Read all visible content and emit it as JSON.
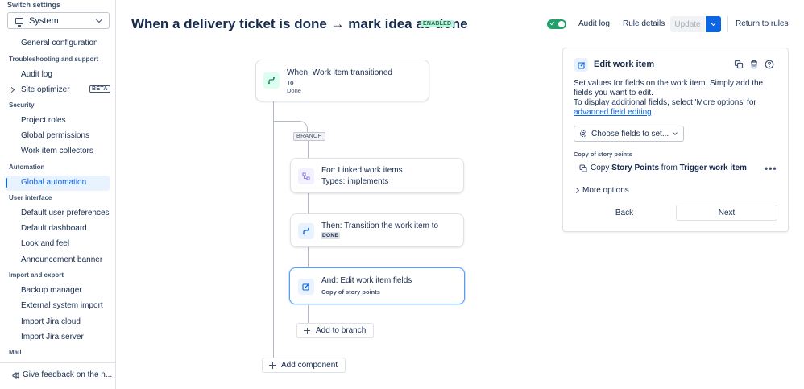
{
  "sidebar": {
    "switch_label": "Switch settings",
    "switch_value": "System",
    "sections": {
      "general": "General configuration",
      "troubleshooting": "Troubleshooting and support",
      "audit_log": "Audit log",
      "site_optimizer": "Site optimizer",
      "beta": "BETA",
      "security": "Security",
      "project_roles": "Project roles",
      "global_permissions": "Global permissions",
      "work_item_collectors": "Work item collectors",
      "automation": "Automation",
      "global_automation": "Global automation",
      "user_interface": "User interface",
      "default_user_preferences": "Default user preferences",
      "default_dashboard": "Default dashboard",
      "look_and_feel": "Look and feel",
      "announcement_banner": "Announcement banner",
      "import_export": "Import and export",
      "backup_manager": "Backup manager",
      "external_system_import": "External system import",
      "import_jira_cloud": "Import Jira cloud",
      "import_jira_server": "Import Jira server",
      "mail": "Mail"
    },
    "feedback": "Give feedback on the n..."
  },
  "header": {
    "title": "When a delivery ticket is done → mark idea as done",
    "status_badge": "ENABLED",
    "audit_log": "Audit log",
    "rule_details": "Rule details",
    "update": "Update",
    "return": "Return to rules",
    "toggle_on": true
  },
  "canvas": {
    "trigger": {
      "title": "When: Work item transitioned",
      "to_label": "To",
      "to_value": "Done"
    },
    "branch_label": "BRANCH",
    "for_card": {
      "title": "For: Linked work items",
      "sub": "Types: implements"
    },
    "then_card": {
      "title": "Then: Transition the work item to",
      "lozenge": "DONE"
    },
    "and_card": {
      "title": "And: Edit work item fields",
      "sub": "Copy of story points"
    },
    "add_to_branch": "Add to branch",
    "add_component": "Add component"
  },
  "panel": {
    "title": "Edit work item",
    "desc_1": "Set values for fields on the work item. Simply add the fields you want to edit.",
    "desc_2": "To display additional fields, select 'More options' for ",
    "desc_link": "advanced field editing",
    "desc_end": ".",
    "choose_fields": "Choose fields to set...",
    "section": "Copy of story points",
    "copy_prefix": "Copy ",
    "copy_field": "Story Points",
    "copy_from": " from ",
    "copy_source": "Trigger work item",
    "more_options": "More options",
    "back": "Back",
    "next": "Next"
  },
  "colors": {
    "accent": "#0c66e4",
    "enabled_green": "#22a06b",
    "badge_bg": "#baf3db"
  }
}
